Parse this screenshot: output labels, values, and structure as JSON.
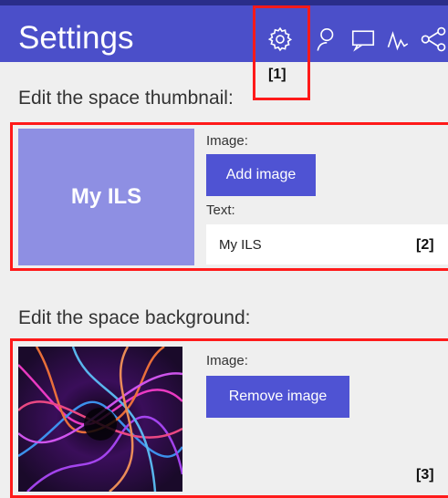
{
  "header": {
    "title": "Settings",
    "icons": [
      "gear-icon",
      "user-icon",
      "comment-icon",
      "activity-icon",
      "share-icon"
    ]
  },
  "thumbnail_section": {
    "heading": "Edit the space thumbnail:",
    "thumbnail_text": "My ILS",
    "image_label": "Image:",
    "add_image_button": "Add image",
    "text_label": "Text:",
    "text_value": "My ILS"
  },
  "background_section": {
    "heading": "Edit the space background:",
    "image_label": "Image:",
    "remove_image_button": "Remove image"
  },
  "annotations": {
    "m1": "[1]",
    "m2": "[2]",
    "m3": "[3]"
  },
  "colors": {
    "header": "#4b4fc9",
    "button": "#4f53d3",
    "thumbnail": "#8e8fe3",
    "highlight": "#ff1a1a"
  }
}
